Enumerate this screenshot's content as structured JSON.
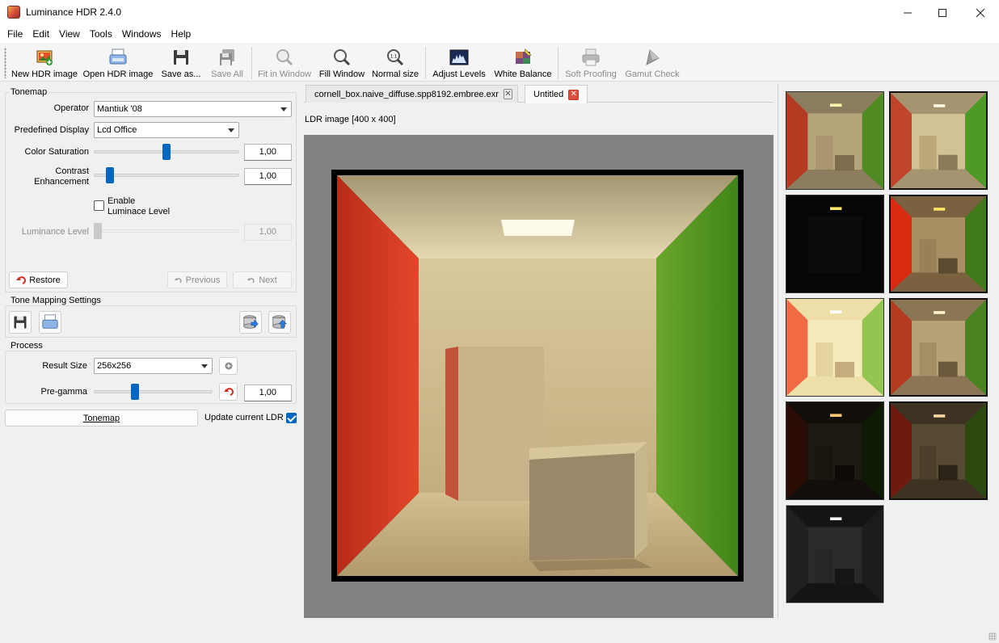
{
  "window": {
    "title": "Luminance HDR 2.4.0"
  },
  "menu": [
    "File",
    "Edit",
    "View",
    "Tools",
    "Windows",
    "Help"
  ],
  "toolbar": {
    "new_hdr": "New HDR image",
    "open_hdr": "Open HDR image",
    "save_as": "Save as...",
    "save_all": "Save All",
    "fit_window": "Fit in Window",
    "fill_window": "Fill Window",
    "normal_size": "Normal size",
    "normal_size_glyph": "1:1",
    "adjust_levels": "Adjust Levels",
    "white_balance": "White Balance",
    "soft_proofing": "Soft Proofing",
    "gamut_check": "Gamut Check"
  },
  "tonemap": {
    "group_title": "Tonemap",
    "operator_label": "Operator",
    "operator_value": "Mantiuk '08",
    "display_label": "Predefined Display",
    "display_value": "Lcd Office",
    "saturation_label": "Color Saturation",
    "saturation_value": "1,00",
    "contrast_label_1": "Contrast",
    "contrast_label_2": "Enhancement",
    "contrast_value": "1,00",
    "enable_label_1": "Enable",
    "enable_label_2": "Luminace Level",
    "luminance_label": "Luminance Level",
    "luminance_value": "1,00",
    "restore": "Restore",
    "previous": "Previous",
    "next": "Next"
  },
  "tm_settings": {
    "group_title": "Tone Mapping Settings"
  },
  "process": {
    "group_title": "Process",
    "result_size_label": "Result Size",
    "result_size_value": "256x256",
    "pregamma_label": "Pre-gamma",
    "pregamma_value": "1,00",
    "tonemap_button": "Tonemap",
    "update_ldr_label": "Update current LDR"
  },
  "tabs": [
    {
      "label": "cornell_box.naive_diffuse.spp8192.embree.exr"
    },
    {
      "label": "Untitled"
    }
  ],
  "viewer": {
    "image_info": "LDR image [400 x 400]"
  },
  "icons": {
    "close": "close-icon",
    "maximize": "maximize-icon",
    "minimize": "minimize-icon"
  },
  "colors": {
    "accent": "#0067c0",
    "wall_red": "#d63a22",
    "wall_green": "#4e9a1e",
    "viewer_bg": "#828282"
  }
}
